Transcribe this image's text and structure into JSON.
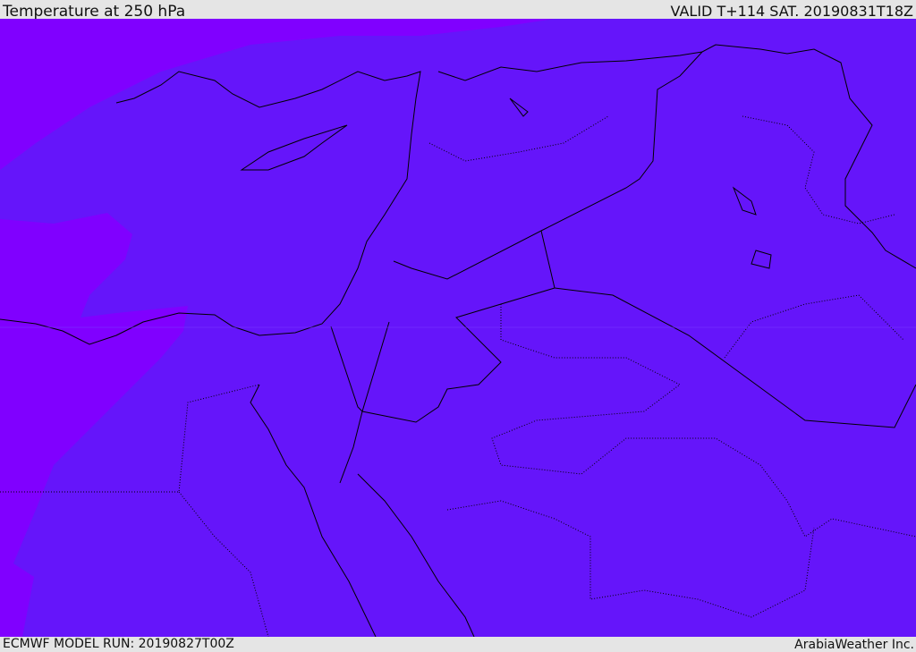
{
  "header": {
    "title": "Temperature at 250 hPa",
    "valid": "VALID T+114 SAT. 20190831T18Z"
  },
  "footer": {
    "model_run": "ECMWF MODEL RUN: 20190827T00Z",
    "brand": "ArabiaWeather Inc."
  },
  "colors": {
    "main_field": "#6515fa",
    "warmer_field": "#8000ff",
    "coastline": "#000000"
  }
}
